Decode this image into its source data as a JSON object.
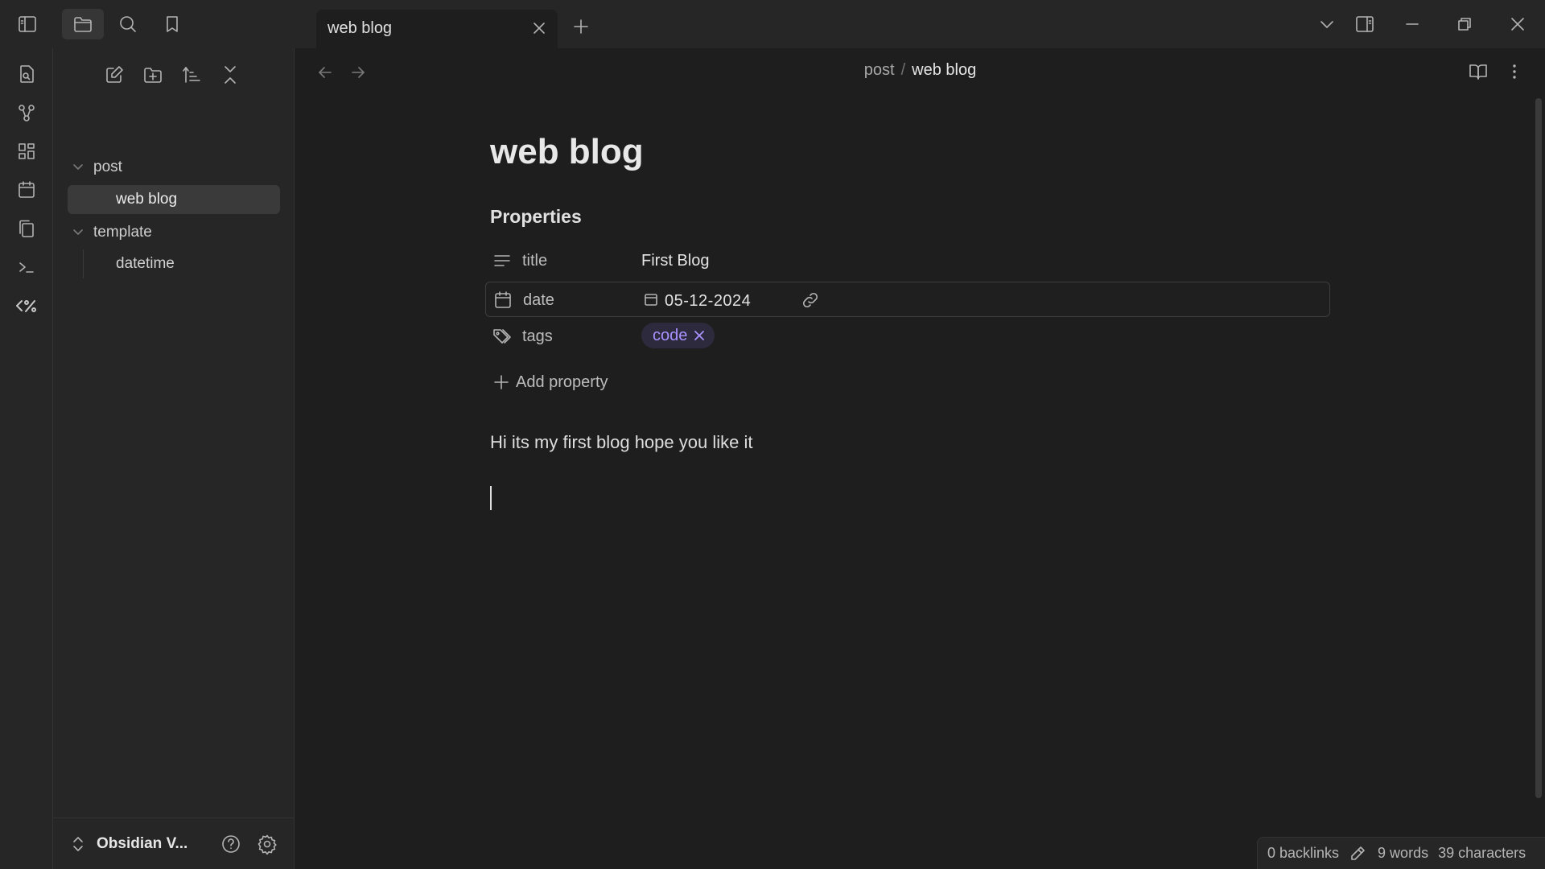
{
  "tabs": [
    {
      "label": "web blog",
      "active": true
    }
  ],
  "sidebar": {
    "tree": {
      "folders": [
        {
          "label": "post",
          "files": [
            {
              "label": "web blog",
              "active": true
            }
          ]
        },
        {
          "label": "template",
          "files": [
            {
              "label": "datetime",
              "active": false
            }
          ]
        }
      ]
    },
    "vault_name": "Obsidian V..."
  },
  "main": {
    "breadcrumb": {
      "parent": "post",
      "separator": "/",
      "current": "web blog"
    },
    "note_title": "web blog",
    "properties_heading": "Properties",
    "properties": [
      {
        "key": "title",
        "value": "First Blog",
        "icon": "text-lines-icon"
      },
      {
        "key": "date",
        "value": "05-12-2024",
        "icon": "calendar-icon"
      },
      {
        "key": "tags",
        "value": "code",
        "icon": "tags-icon"
      }
    ],
    "add_property_label": "Add property",
    "body_text": "Hi its my first blog hope you like it"
  },
  "status": {
    "backlinks": "0 backlinks",
    "words": "9 words",
    "characters": "39 characters"
  },
  "colors": {
    "background": "#1e1e1e",
    "panel": "#262626",
    "accent_tag": "#a992ff",
    "tag_bg": "#2e2a3d"
  }
}
